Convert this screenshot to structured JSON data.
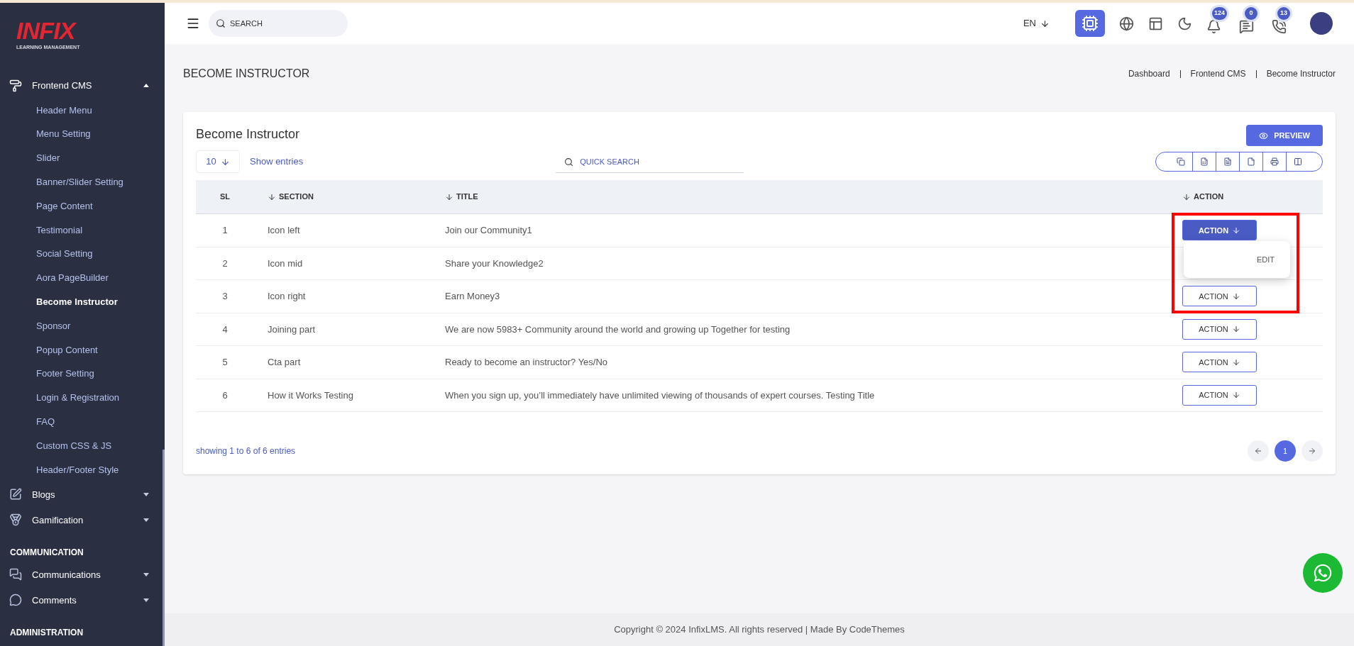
{
  "sidebar": {
    "logo": {
      "brand": "INFIX",
      "tagline": "LEARNING MANAGEMENT"
    },
    "groups": [
      {
        "kind": "menu",
        "label": "Frontend CMS",
        "expanded": true,
        "children": [
          {
            "label": "Header Menu",
            "selected": false
          },
          {
            "label": "Menu Setting",
            "selected": false
          },
          {
            "label": "Slider",
            "selected": false
          },
          {
            "label": "Banner/Slider Setting",
            "selected": false
          },
          {
            "label": "Page Content",
            "selected": false
          },
          {
            "label": "Testimonial",
            "selected": false
          },
          {
            "label": "Social Setting",
            "selected": false
          },
          {
            "label": "Aora PageBuilder",
            "selected": false
          },
          {
            "label": "Become Instructor",
            "selected": true
          },
          {
            "label": "Sponsor",
            "selected": false
          },
          {
            "label": "Popup Content",
            "selected": false
          },
          {
            "label": "Footer Setting",
            "selected": false
          },
          {
            "label": "Login & Registration",
            "selected": false
          },
          {
            "label": "FAQ",
            "selected": false
          },
          {
            "label": "Custom CSS & JS",
            "selected": false
          },
          {
            "label": "Header/Footer Style",
            "selected": false
          }
        ]
      },
      {
        "kind": "menu",
        "label": "Blogs",
        "expanded": false
      },
      {
        "kind": "menu",
        "label": "Gamification",
        "expanded": false
      },
      {
        "kind": "heading",
        "label": "COMMUNICATION"
      },
      {
        "kind": "menu",
        "label": "Communications",
        "expanded": false
      },
      {
        "kind": "menu",
        "label": "Comments",
        "expanded": false
      },
      {
        "kind": "heading",
        "label": "ADMINISTRATION"
      }
    ]
  },
  "top_bar": {
    "search": {
      "placeholder": "SEARCH"
    },
    "language": "EN",
    "ai_button": {
      "selected": true
    },
    "notifications": [
      {
        "count": "124"
      },
      {
        "count": "0"
      },
      {
        "count": "13"
      }
    ]
  },
  "page": {
    "title": "BECOME INSTRUCTOR",
    "breadcrumb": [
      "Dashboard",
      "Frontend CMS",
      "Become Instructor"
    ]
  },
  "card": {
    "title": "Become Instructor",
    "preview_button": "PREVIEW",
    "page_size": "10",
    "show_entries": "Show entries",
    "quick_search": {
      "placeholder": "QUICK SEARCH"
    },
    "table": {
      "columns": [
        {
          "label": "SL",
          "sortable": false
        },
        {
          "label": "SECTION",
          "sortable": true
        },
        {
          "label": "TITLE",
          "sortable": true
        },
        {
          "label": "ACTION",
          "sortable": true
        }
      ],
      "rows": [
        {
          "sl": "1",
          "section": "Icon left",
          "title": "Join our Community1",
          "action": {
            "label": "ACTION",
            "selected": true
          }
        },
        {
          "sl": "2",
          "section": "Icon mid",
          "title": "Share your Knowledge2"
        },
        {
          "sl": "3",
          "section": "Icon right",
          "title": "Earn Money3",
          "action": {
            "label": "ACTION",
            "selected": false
          }
        },
        {
          "sl": "4",
          "section": "Joining part",
          "title": "We are now 5983+ Community around the world and growing up Together for testing",
          "action": {
            "label": "ACTION",
            "selected": false
          }
        },
        {
          "sl": "5",
          "section": "Cta part",
          "title": "Ready to become an instructor? Yes/No",
          "action": {
            "label": "ACTION",
            "selected": false
          }
        },
        {
          "sl": "6",
          "section": "How it Works Testing",
          "title": "When you sign up, you’ll immediately have unlimited viewing of thousands of expert courses. Testing Title",
          "action": {
            "label": "ACTION",
            "selected": false
          }
        }
      ],
      "action_menu": {
        "items": [
          "EDIT"
        ],
        "highlighted": true
      }
    },
    "summary": "showing 1 to 6 of 6 entries",
    "pagination": [
      {
        "label": "1",
        "selected": true
      }
    ]
  },
  "footer": "Copyright © 2024 InfixLMS. All rights reserved | Made By CodeThemes"
}
